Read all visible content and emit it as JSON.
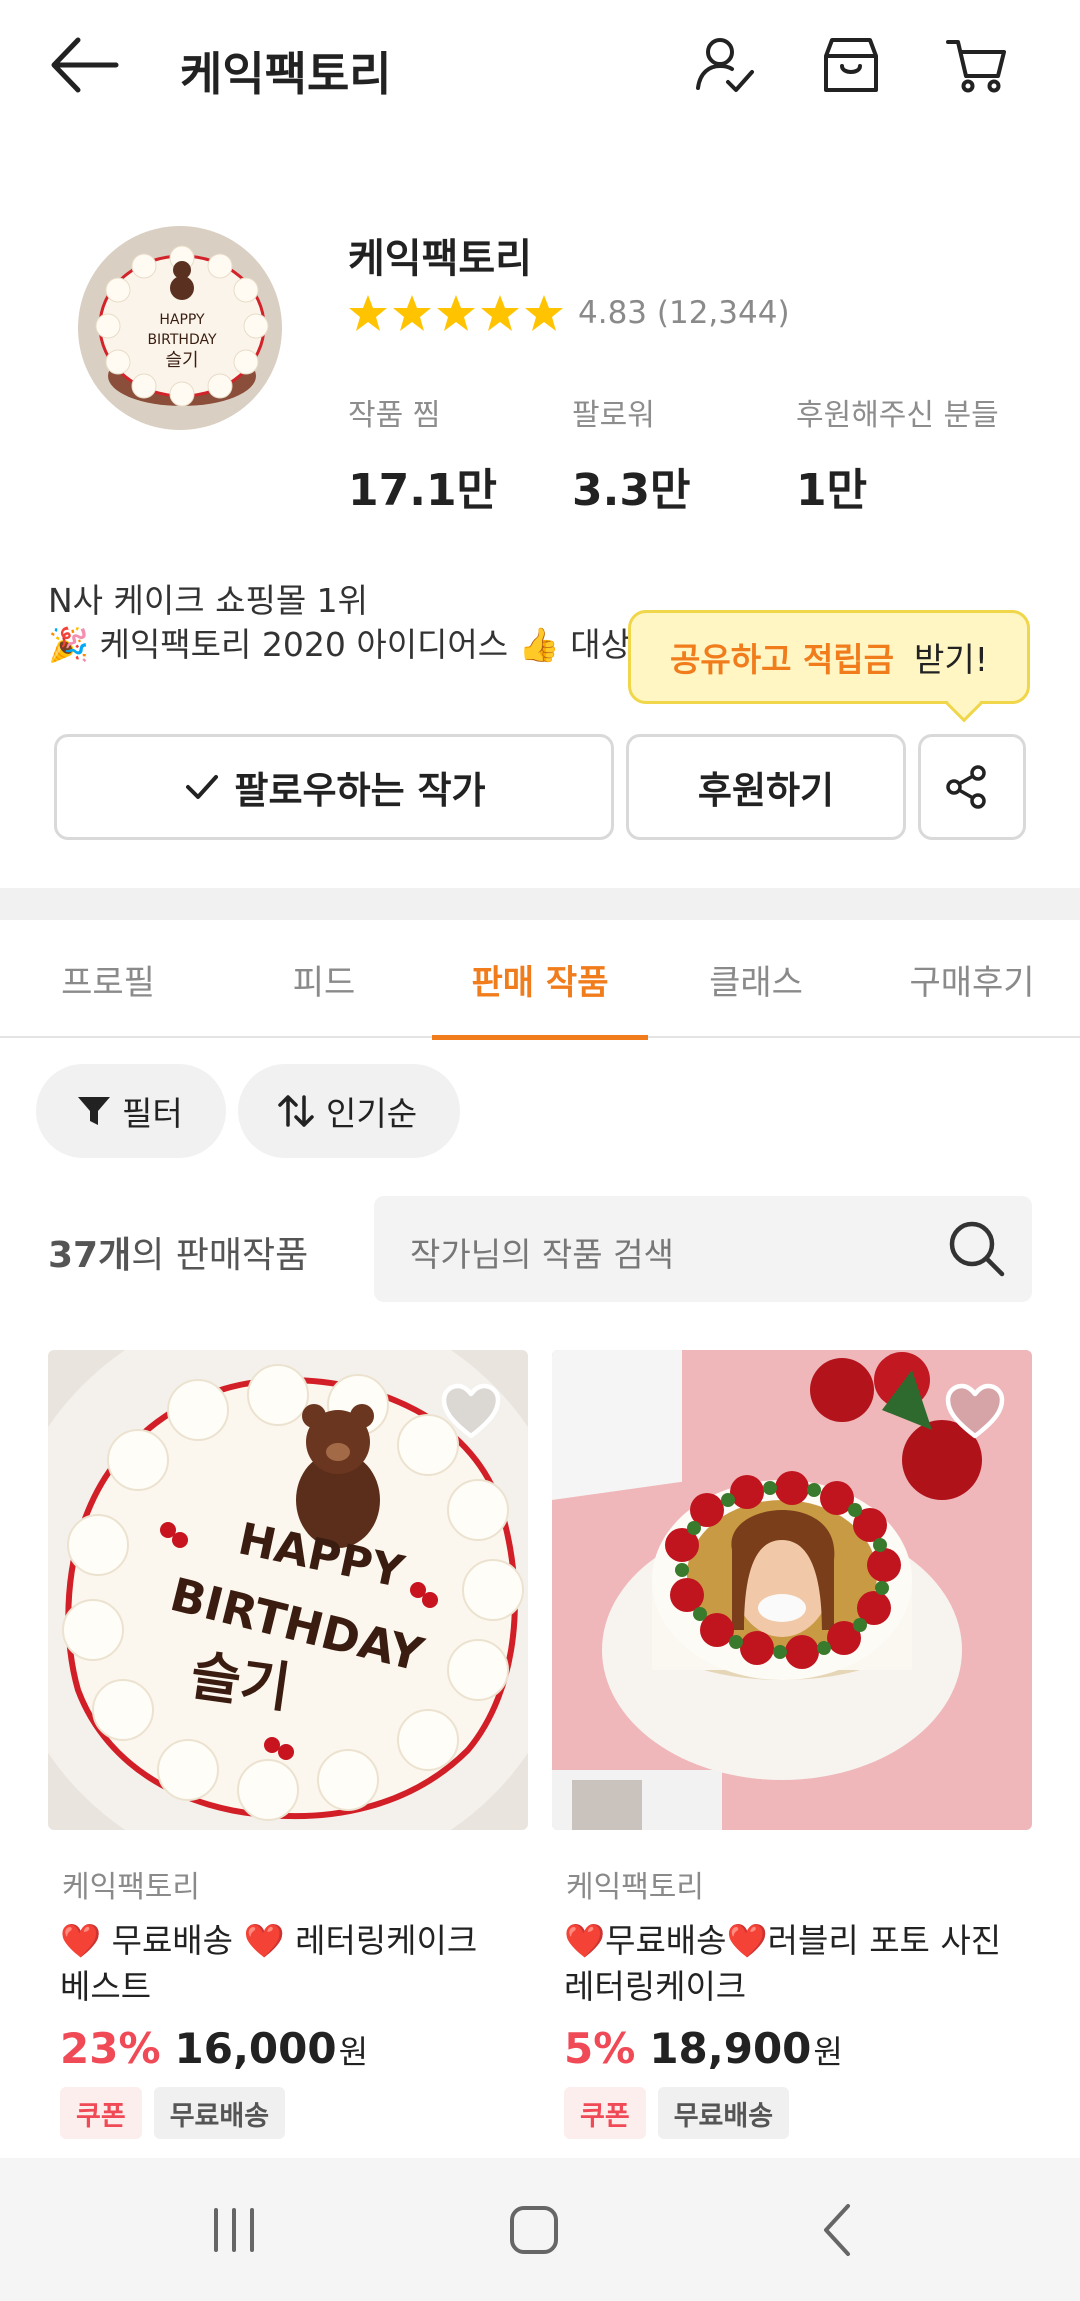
{
  "topbar": {
    "title": "케익팩토리",
    "icons": [
      "back-arrow-icon",
      "follow-user-icon",
      "shop-icon",
      "cart-icon"
    ]
  },
  "profile": {
    "name": "케익팩토리",
    "rating_value": 4.83,
    "rating_text": "4.83 (12,344)",
    "stars_filled": 5,
    "stats": [
      {
        "label": "작품 찜",
        "value": "17.1만"
      },
      {
        "label": "팔로워",
        "value": "3.3만"
      },
      {
        "label": "후원해주신 분들",
        "value": "1만"
      }
    ],
    "desc_line1": "N사 케이크 쇼핑몰 1위",
    "desc_line2": "🎉 케익팩토리 2020 아이디어스 👍 대상"
  },
  "tooltip": {
    "highlight": "공유하고 적립금",
    "rest": "받기!"
  },
  "actions": {
    "follow_label": "팔로우하는 작가",
    "support_label": "후원하기"
  },
  "tabs": [
    "프로필",
    "피드",
    "판매 작품",
    "클래스",
    "구매후기"
  ],
  "active_tab": "판매 작품",
  "filters": {
    "filter_label": "필터",
    "sort_label": "인기순"
  },
  "listing": {
    "count_num": "37개",
    "count_suffix": "의 판매작품",
    "search_placeholder": "작가님의 작품 검색"
  },
  "products": [
    {
      "seller": "케익팩토리",
      "name": "❤️ 무료배송 ❤️ 레터링케이크 베스트",
      "discount": "23%",
      "price": "16,000",
      "currency": "원",
      "badges": [
        "쿠폰",
        "무료배송"
      ]
    },
    {
      "seller": "케익팩토리",
      "name": "❤️무료배송❤️러블리 포토 사진 레터링케이크",
      "discount": "5%",
      "price": "18,900",
      "currency": "원",
      "badges": [
        "쿠폰",
        "무료배송"
      ]
    }
  ],
  "cake_text": [
    "HAPPY",
    "BIRTHDAY",
    "슬기"
  ],
  "colors": {
    "accent": "#f07c1c",
    "discount": "#ef4a56",
    "star": "#ffc300",
    "tooltip_bg": "#fff6c4"
  }
}
